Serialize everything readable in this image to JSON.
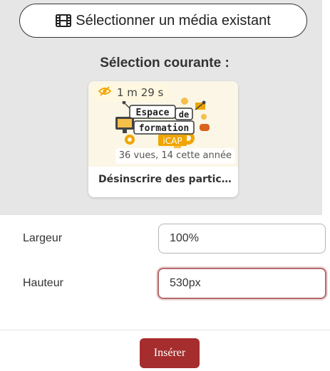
{
  "media_selector": {
    "button_label": "Sélectionner un média existant",
    "current_selection_title": "Sélection courante :"
  },
  "media_card": {
    "duration": "1 m 29 s",
    "views": "36 vues, 14 cette année",
    "title": "Désinscrire des participants",
    "thumbnail": {
      "line1": "Espace",
      "line2": "de",
      "line3": "formation",
      "line4": "iCAP"
    }
  },
  "form": {
    "width_label": "Largeur",
    "width_value": "100%",
    "height_label": "Hauteur",
    "height_value": "530px"
  },
  "actions": {
    "insert_label": "Insérer"
  },
  "colors": {
    "panel_bg": "#e6e6e6",
    "primary": "#a62d2d",
    "focus_border": "#b46a6a",
    "badge_icon": "#f0a500"
  }
}
